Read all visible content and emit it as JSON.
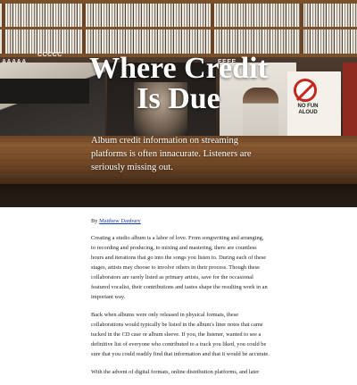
{
  "hero": {
    "title_line1": "Where Credit",
    "title_line2": "Is Due",
    "subtitle": "Album credit information on streaming platforms is often innacurate. Listeners are seriously missing out.",
    "photo_text": {
      "bin_label_left": "AAAAA",
      "bin_label_mid": "CCCCC",
      "bin_label_right": "EEEE",
      "album_sign": "NO FUN ALOUD"
    }
  },
  "article": {
    "byline_prefix": "By",
    "author": "Matthew Danbury",
    "paragraphs": [
      "Creating a studio album is a labor of love. From songwriting and arranging, to recording and producing, to mixing and mastering, there are countless hours and iterations that go into the songs you listen to. During each of these stages, artists may choose to involve others in their process. Though these collaborators are rarely listed as primary artists, save for the occasional featured vocalist, their contributions and tastes shape the resulting work in an important way.",
      "Back when albums were only released in physical formats, these collaborations would typically be listed in the album's liner notes that came tucked in the CD case or album sleeve. If you, the listener, wanted to see a definitive list of everyone who contributed to a track you liked, you could be sure that you could readily find that information and that it would be accurate.",
      "With the advent of digital formats, online distribution platforms, and later"
    ]
  }
}
